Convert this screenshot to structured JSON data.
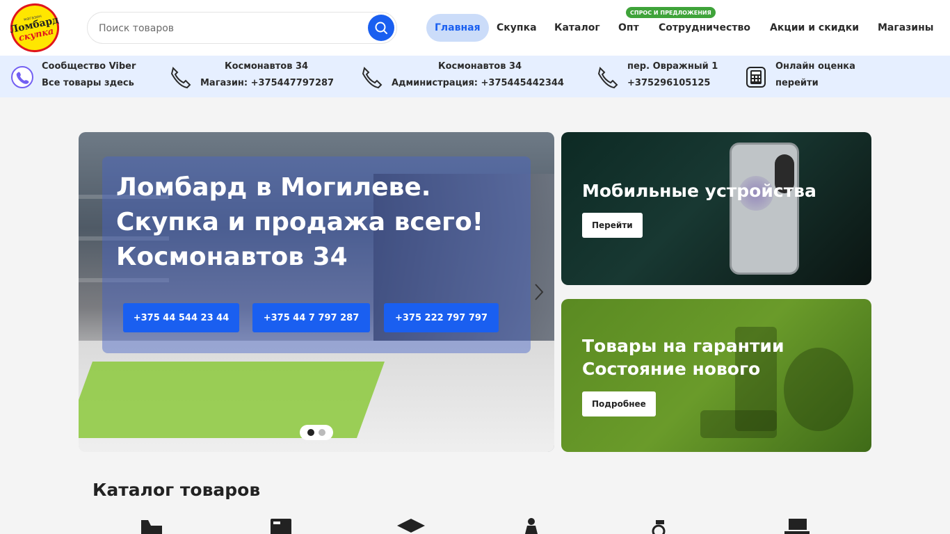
{
  "logo": {
    "top": "Ломбард",
    "bottom": "скупка",
    "small": "магазин"
  },
  "search": {
    "placeholder": "Поиск товаров"
  },
  "nav": {
    "items": [
      "Главная",
      "Скупка",
      "Каталог",
      "Опт",
      "Сотрудничество",
      "Акции и скидки",
      "Магазины"
    ],
    "active": "Главная",
    "opt_badge": "СПРОС И ПРЕДЛОЖЕНИЯ"
  },
  "infobar": {
    "viber": {
      "line1": "Сообщество Viber",
      "line2": "Все товары здесь"
    },
    "shop1": {
      "line1": "Космонавтов 34",
      "line2": "Магазин: +375447797287"
    },
    "shop2": {
      "line1": "Космонавтов 34",
      "line2": "Администрация: +375445442344"
    },
    "shop3": {
      "line1": "пер. Овражный 1",
      "line2": "+375296105125"
    },
    "online": {
      "line1": "Онлайн оценка",
      "line2": "перейти"
    }
  },
  "hero": {
    "title_lines": [
      "Ломбард в Могилеве.",
      "Скупка и продажа всего!",
      "Космонавтов 34"
    ],
    "buttons": [
      "+375 44 544 23 44",
      "+375 44 7 797 287",
      "+375 222 797 797"
    ],
    "slides": 2,
    "active_slide": 1
  },
  "cards": [
    {
      "title_lines": [
        "Мобильные устройства"
      ],
      "button": "Перейти"
    },
    {
      "title_lines": [
        "Товары на гарантии",
        "Состояние нового"
      ],
      "button": "Подробнее"
    }
  ],
  "catalog": {
    "title": "Каталог товаров"
  },
  "colors": {
    "accent": "#1a5ff0",
    "badge": "#3fa33a",
    "infobar": "#e6efff",
    "nav_active_bg": "#cbdcf9"
  }
}
